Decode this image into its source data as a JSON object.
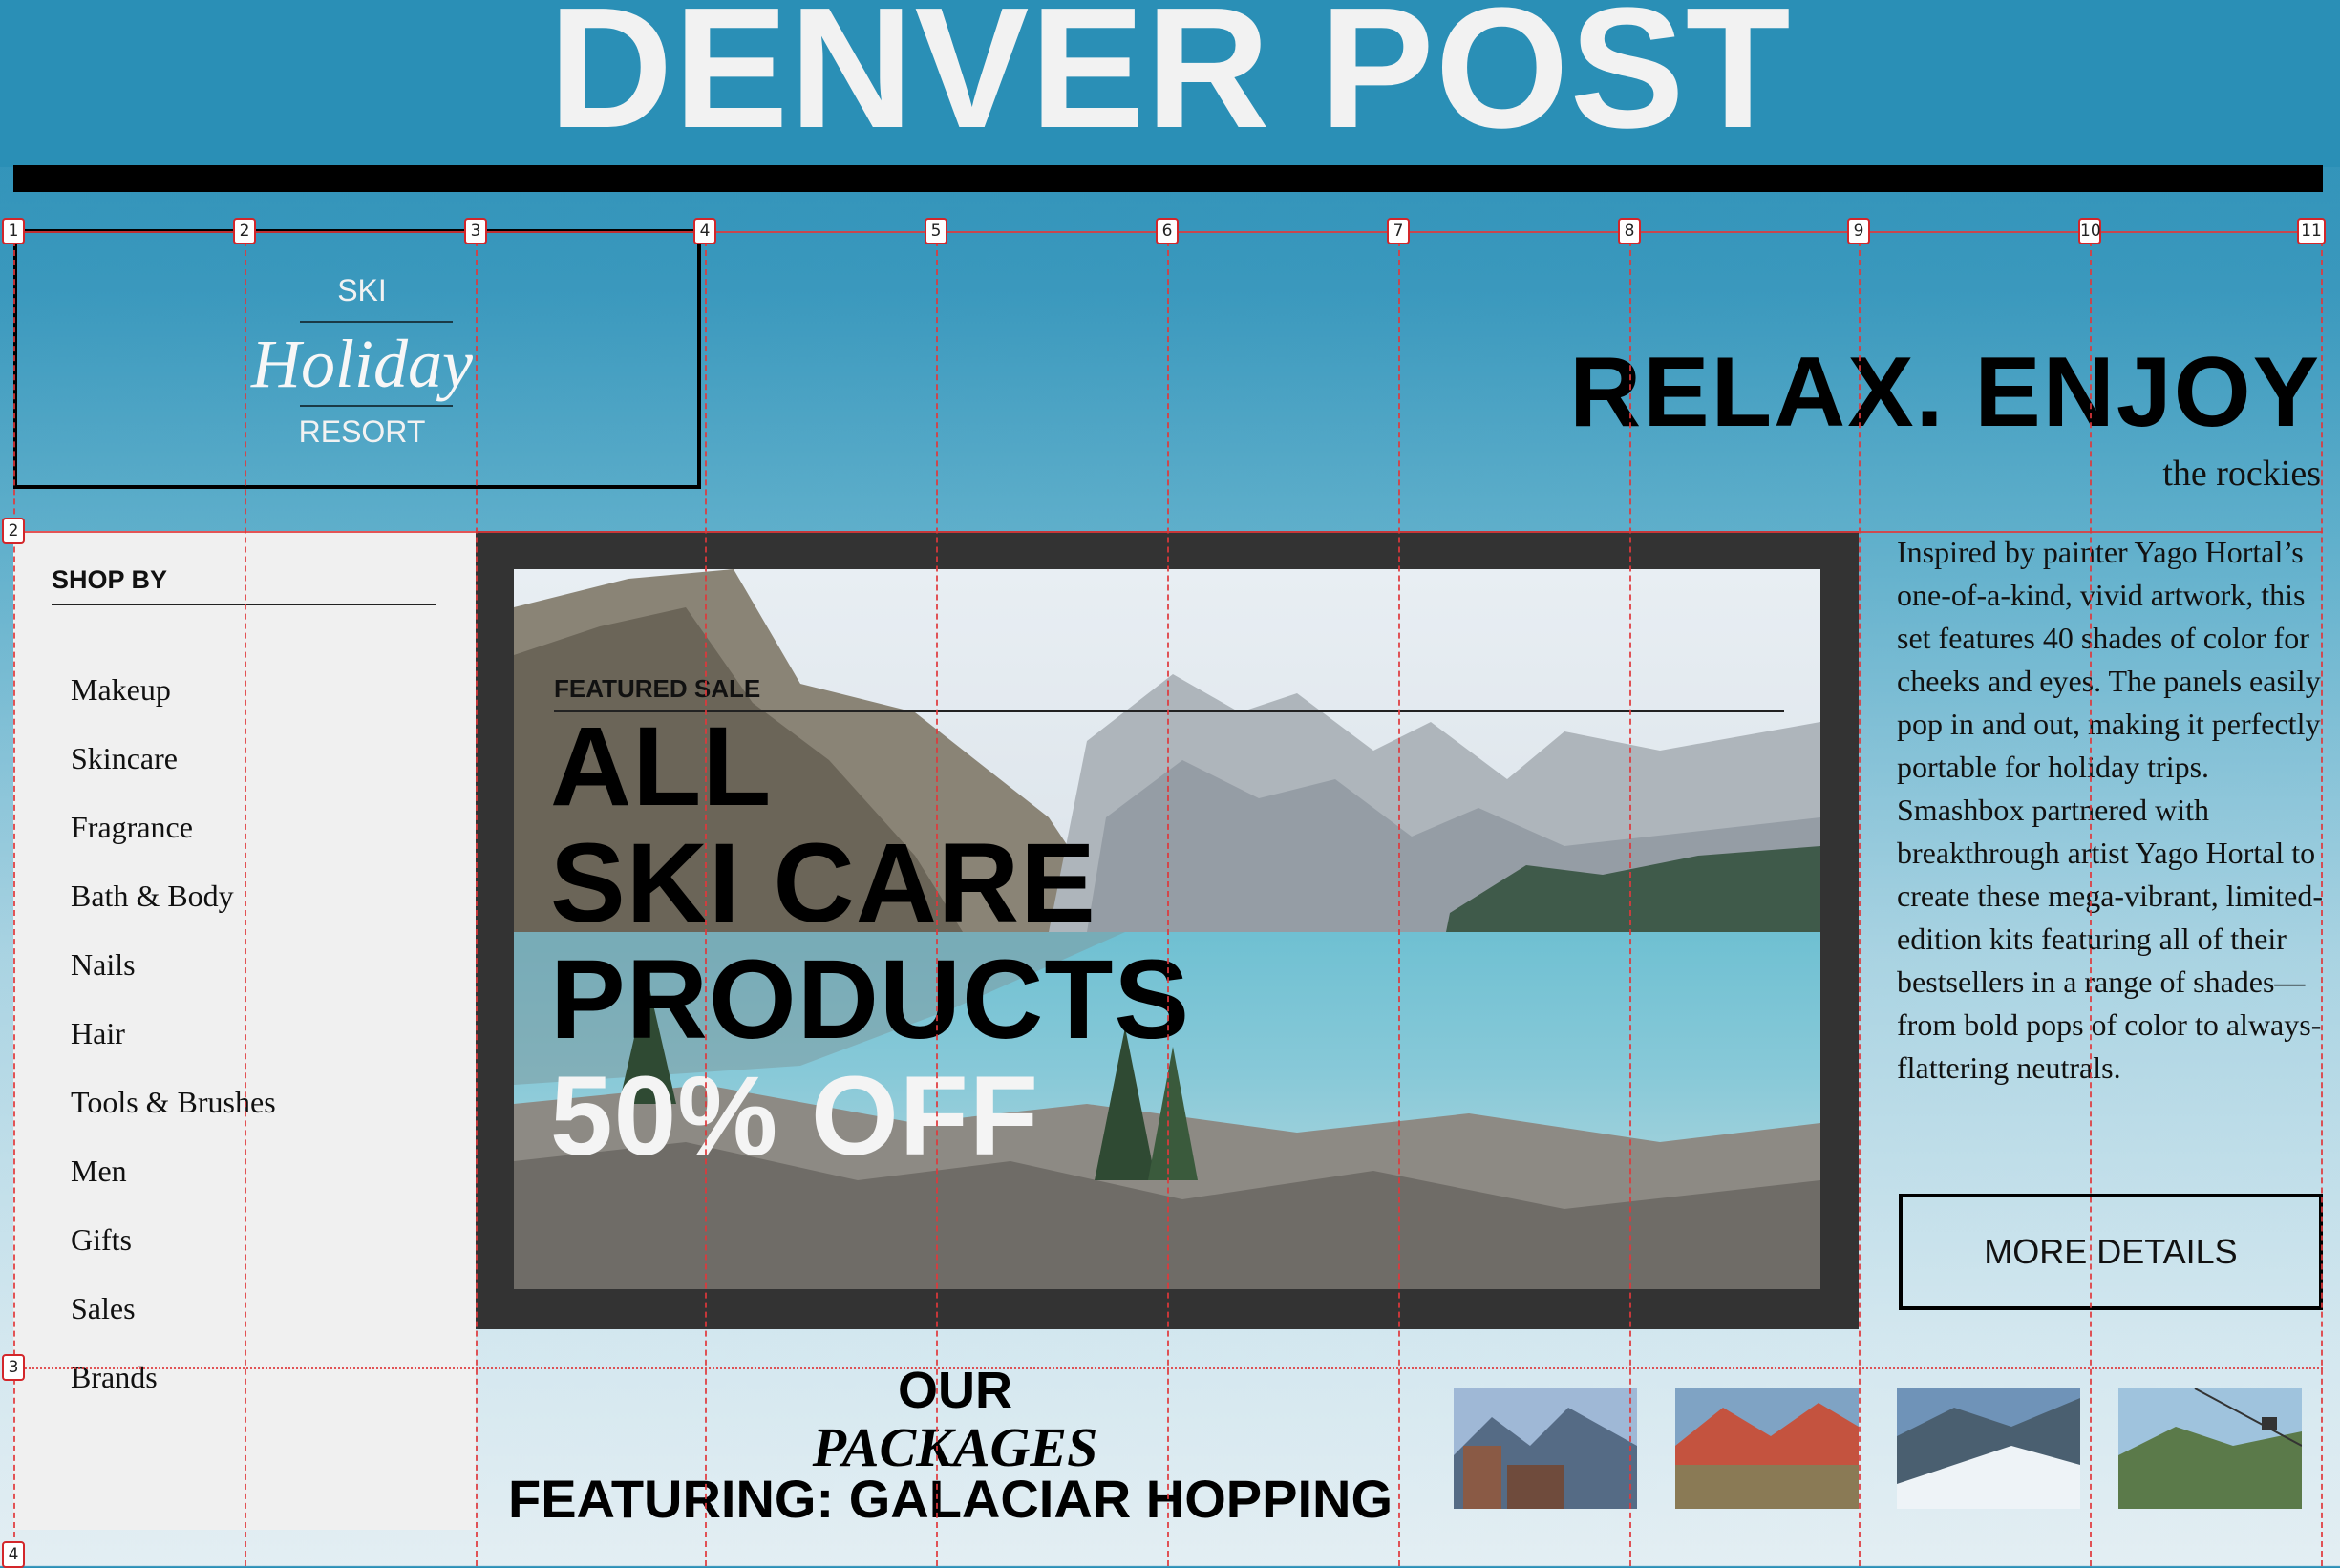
{
  "masthead": {
    "title": "DENVER POST"
  },
  "grid": {
    "columns": [
      "1",
      "2",
      "3",
      "4",
      "5",
      "6",
      "7",
      "8",
      "9",
      "10",
      "11"
    ],
    "rows": [
      "1",
      "2",
      "3",
      "4"
    ]
  },
  "logo": {
    "line1": "SKI",
    "line2": "Holiday",
    "line3": "RESORT"
  },
  "hero_heading": {
    "headline": "RELAX. ENJOY",
    "subhead": "the rockies"
  },
  "sidebar": {
    "heading": "SHOP BY",
    "items": [
      "Makeup",
      "Skincare",
      "Fragrance",
      "Bath & Body",
      "Nails",
      "Hair",
      "Tools & Brushes",
      "Men",
      "Gifts",
      "Sales",
      "Brands"
    ]
  },
  "featured": {
    "label": "FEATURED SALE",
    "line1": "ALL",
    "line2": "SKI CARE",
    "line3": "PRODUCTS",
    "line4": "50% OFF"
  },
  "blurb": {
    "text": "Inspired by painter Yago Hortal’s one-of-a-kind, vivid artwork, this set features 40 shades of color for cheeks and eyes. The panels easily pop in and out, making it perfectly portable for holiday trips. Smashbox partnered with breakthrough artist Yago Hortal to create these mega-vibrant, limited-edition kits featuring all of their bestsellers in a range of shades—from bold pops of color to always-flattering neutrals.",
    "button": "MORE DETAILS"
  },
  "packages": {
    "line1": "OUR",
    "line2": "PACKAGES",
    "line3": "FEATURING: GALACIAR HOPPING"
  },
  "colors": {
    "header_bg": "#2a8fb6",
    "frame": "#333333",
    "grid_lines": "#e0383b",
    "sidebar_bg": "#f0f0f0"
  }
}
